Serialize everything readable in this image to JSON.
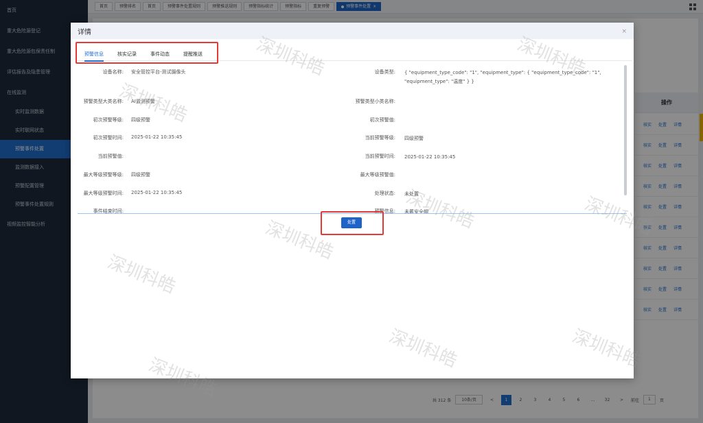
{
  "sidebar": {
    "items": [
      {
        "label": "首页"
      },
      {
        "label": "重大危险源登记"
      },
      {
        "label": "重大危险源包保责任制"
      },
      {
        "label": "评估报告及隐患管理"
      },
      {
        "label": "在线监测"
      },
      {
        "label": "实时监测数据"
      },
      {
        "label": "实时联网状态"
      },
      {
        "label": "预警事件处置"
      },
      {
        "label": "监测数据接入"
      },
      {
        "label": "预警配置管理"
      },
      {
        "label": "预警事件处置规则"
      },
      {
        "label": "视频监控智能分析"
      }
    ]
  },
  "tabs": [
    "首页",
    "预警排名",
    "首页",
    "预警事件处置规则",
    "预警推送规则",
    "预警指标统计",
    "预警指标",
    "重复预警",
    "预警事件处置"
  ],
  "table": {
    "header": "操作",
    "actions": {
      "verify": "核实",
      "handle": "处置",
      "detail": "详情"
    }
  },
  "pagination": {
    "total": "共 312 条",
    "page_size": "10条/页",
    "prev": "<",
    "pages": [
      "1",
      "2",
      "3",
      "4",
      "5",
      "6",
      "…",
      "32"
    ],
    "next": ">",
    "goto_label": "前往",
    "goto_value": "1",
    "goto_unit": "页"
  },
  "modal": {
    "title": "详情",
    "close": "×",
    "tabs": [
      "预警信息",
      "核实记录",
      "事件动态",
      "提醒推送"
    ],
    "fields": {
      "device_name_label": "设备名称:",
      "device_name": "安全管控平台-测试摄像头",
      "device_type_label": "设备类型:",
      "device_type": "{ \"equipment_type_code\": \"1\", \"equipment_type\": { \"equipment_type_code\": \"1\", \"equipment_type\": \"温度\" } }",
      "alarm_major_label": "预警类型大类名称:",
      "alarm_major": "AI监测预警",
      "alarm_minor_label": "预警类型小类名称:",
      "alarm_minor": "",
      "first_level_label": "初次预警等级:",
      "first_level": "四级预警",
      "first_value_label": "初次预警值:",
      "first_value": "",
      "first_time_label": "初次预警时间:",
      "first_time": "2025-01-22 10:35:45",
      "current_level_label": "当前预警等级:",
      "current_level": "四级预警",
      "current_value_label": "当前预警值:",
      "current_value": "",
      "current_time_label": "当前预警时间:",
      "current_time": "2025-01-22 10:35:45",
      "max_level_label": "最大等级预警等级:",
      "max_level": "四级预警",
      "max_value_label": "最大等级预警值:",
      "max_value": "",
      "max_time_label": "最大等级预警时间:",
      "max_time": "2025-01-22 10:35:45",
      "status_label": "处理状态:",
      "status": "未处置",
      "end_time_label": "事件结束时间:",
      "end_time": "",
      "alarm_info_label": "预警信息:",
      "alarm_info": "未戴安全帽"
    },
    "action_button": "处置"
  },
  "watermark": "深圳科皓"
}
